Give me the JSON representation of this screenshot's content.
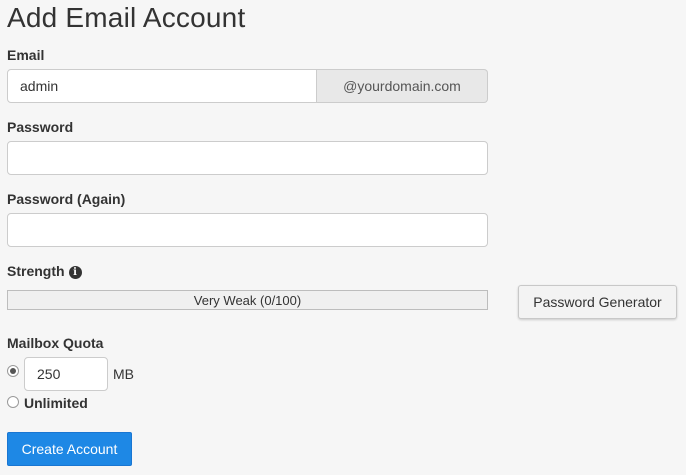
{
  "page": {
    "title": "Add Email Account"
  },
  "email": {
    "label": "Email",
    "value": "admin",
    "domain": "@yourdomain.com"
  },
  "password": {
    "label": "Password",
    "value": ""
  },
  "password_again": {
    "label": "Password (Again)",
    "value": ""
  },
  "strength": {
    "label": "Strength",
    "info_icon": "info-circle-icon",
    "text": "Very Weak (0/100)",
    "score": 0,
    "max": 100
  },
  "password_generator": {
    "label": "Password Generator"
  },
  "quota": {
    "label": "Mailbox Quota",
    "value": "250",
    "unit": "MB",
    "selected": "limited",
    "unlimited_label": "Unlimited"
  },
  "create_button": {
    "label": "Create Account",
    "color": "#1e88e5"
  }
}
